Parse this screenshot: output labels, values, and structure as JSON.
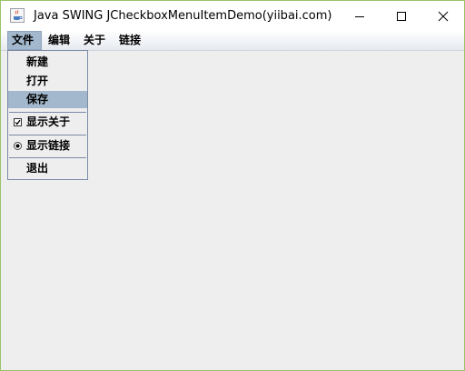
{
  "window": {
    "title": "Java SWING JCheckboxMenuItemDemo(yiibai.com)",
    "icon": "java-cup-icon"
  },
  "menubar": {
    "menus": [
      {
        "label": "文件",
        "active": true
      },
      {
        "label": "编辑"
      },
      {
        "label": "关于"
      },
      {
        "label": "链接"
      }
    ]
  },
  "file_menu": {
    "items": [
      {
        "label": "新建"
      },
      {
        "label": "打开"
      },
      {
        "label": "保存",
        "highlighted": true
      },
      {
        "label": "显示关于",
        "type": "checkbox",
        "checked": true
      },
      {
        "label": "显示链接",
        "type": "radio",
        "selected": true
      },
      {
        "label": "退出"
      }
    ]
  },
  "colors": {
    "window_border": "#9bc36b",
    "client_bg": "#eeeeee",
    "menu_highlight": "#a3b8cc",
    "popup_border": "#7a8aa6"
  }
}
